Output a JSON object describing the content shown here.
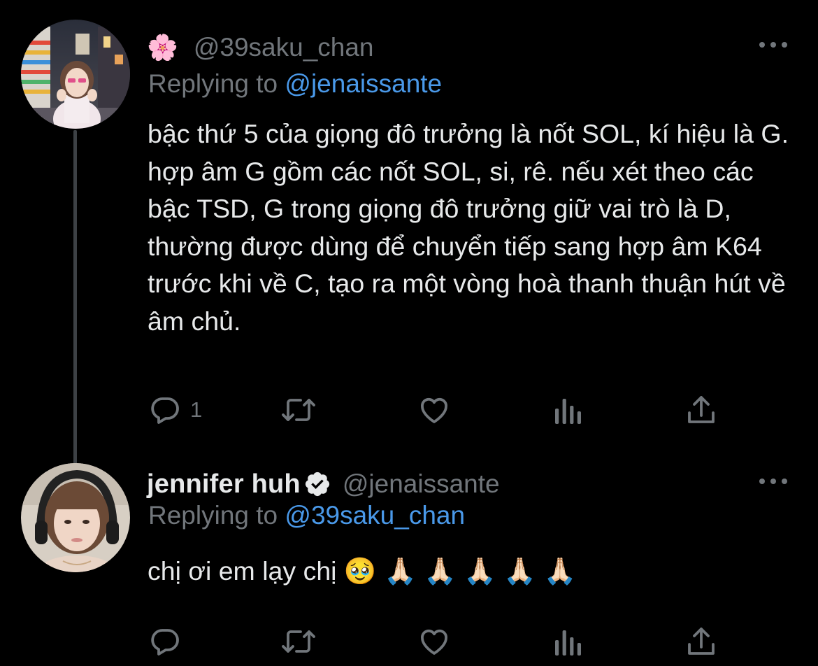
{
  "tweets": [
    {
      "emoji": "🌸",
      "display_name": "",
      "verified": false,
      "handle": "@39saku_chan",
      "reply_label": "Replying to",
      "reply_to": "@jenaissante",
      "text": "bậc thứ 5 của giọng đô trưởng là nốt SOL, kí hiệu là G. hợp âm G gồm các nốt SOL, si, rê. nếu xét theo các bậc TSD, G trong giọng đô trưởng giữ vai trò là D, thường được dùng để chuyển tiếp sang hợp âm K64 trước khi về C, tạo ra một vòng hoà thanh thuận hút về âm chủ.",
      "reply_count": "1"
    },
    {
      "emoji": "",
      "display_name": "jennifer huh",
      "verified": true,
      "handle": "@jenaissante",
      "reply_label": "Replying to",
      "reply_to": "@39saku_chan",
      "text": "chị ơi em lạy chị 🥹 🙏🏻 🙏🏻 🙏🏻 🙏🏻 🙏🏻",
      "reply_count": ""
    }
  ],
  "icons": {
    "reply": "reply-icon",
    "retweet": "retweet-icon",
    "like": "like-icon",
    "views": "views-icon",
    "share": "share-icon",
    "more": "more-icon",
    "verified": "verified-badge-icon"
  },
  "colors": {
    "background": "#000000",
    "text": "#e7e9ea",
    "secondary": "#71767b",
    "link": "#4a99e9",
    "thread_line": "#3d4145"
  }
}
